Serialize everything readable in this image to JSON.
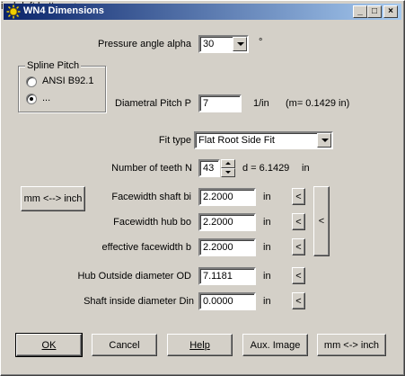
{
  "window": {
    "title": "WN4 Dimensions",
    "controls": {
      "minimize": "_",
      "maximize": "□",
      "close": "×"
    }
  },
  "pressure_angle": {
    "label": "Pressure angle alpha",
    "value": "30",
    "unit": "°"
  },
  "spline_pitch": {
    "group_title": "Spline Pitch",
    "options": [
      {
        "label": "ANSI B92.1",
        "selected": false
      },
      {
        "label": "...",
        "selected": true
      }
    ]
  },
  "diametral_pitch": {
    "label": "Diametral Pitch P",
    "value": "7",
    "unit": "1/in",
    "note": "(m= 0.1429 in)"
  },
  "fit_type": {
    "label": "Fit type",
    "value": "Flat Root Side Fit"
  },
  "teeth": {
    "label": "Number of teeth N",
    "value": "43",
    "diameter_text": "d = 6.1429",
    "unit": "in"
  },
  "fields": [
    {
      "label": "Facewidth shaft bi",
      "value": "2.2000",
      "unit": "in",
      "button": "<"
    },
    {
      "label": "Facewidth hub bo",
      "value": "2.2000",
      "unit": "in",
      "button": "<"
    },
    {
      "label": "effective facewidth b",
      "value": "2.2000",
      "unit": "in",
      "button": "<"
    },
    {
      "label": "Hub Outside diameter OD",
      "value": "7.1181",
      "unit": "in",
      "button": "<"
    },
    {
      "label": "Shaft inside diameter  Din",
      "value": "0.0000",
      "unit": "in",
      "button": "<"
    }
  ],
  "group_button": "<",
  "unit_toggle_left": "mm <--> inch",
  "buttons": {
    "ok": "OK",
    "cancel": "Cancel",
    "help": "Help",
    "aux_image": "Aux. Image",
    "unit_toggle": "mm <-> inch"
  }
}
